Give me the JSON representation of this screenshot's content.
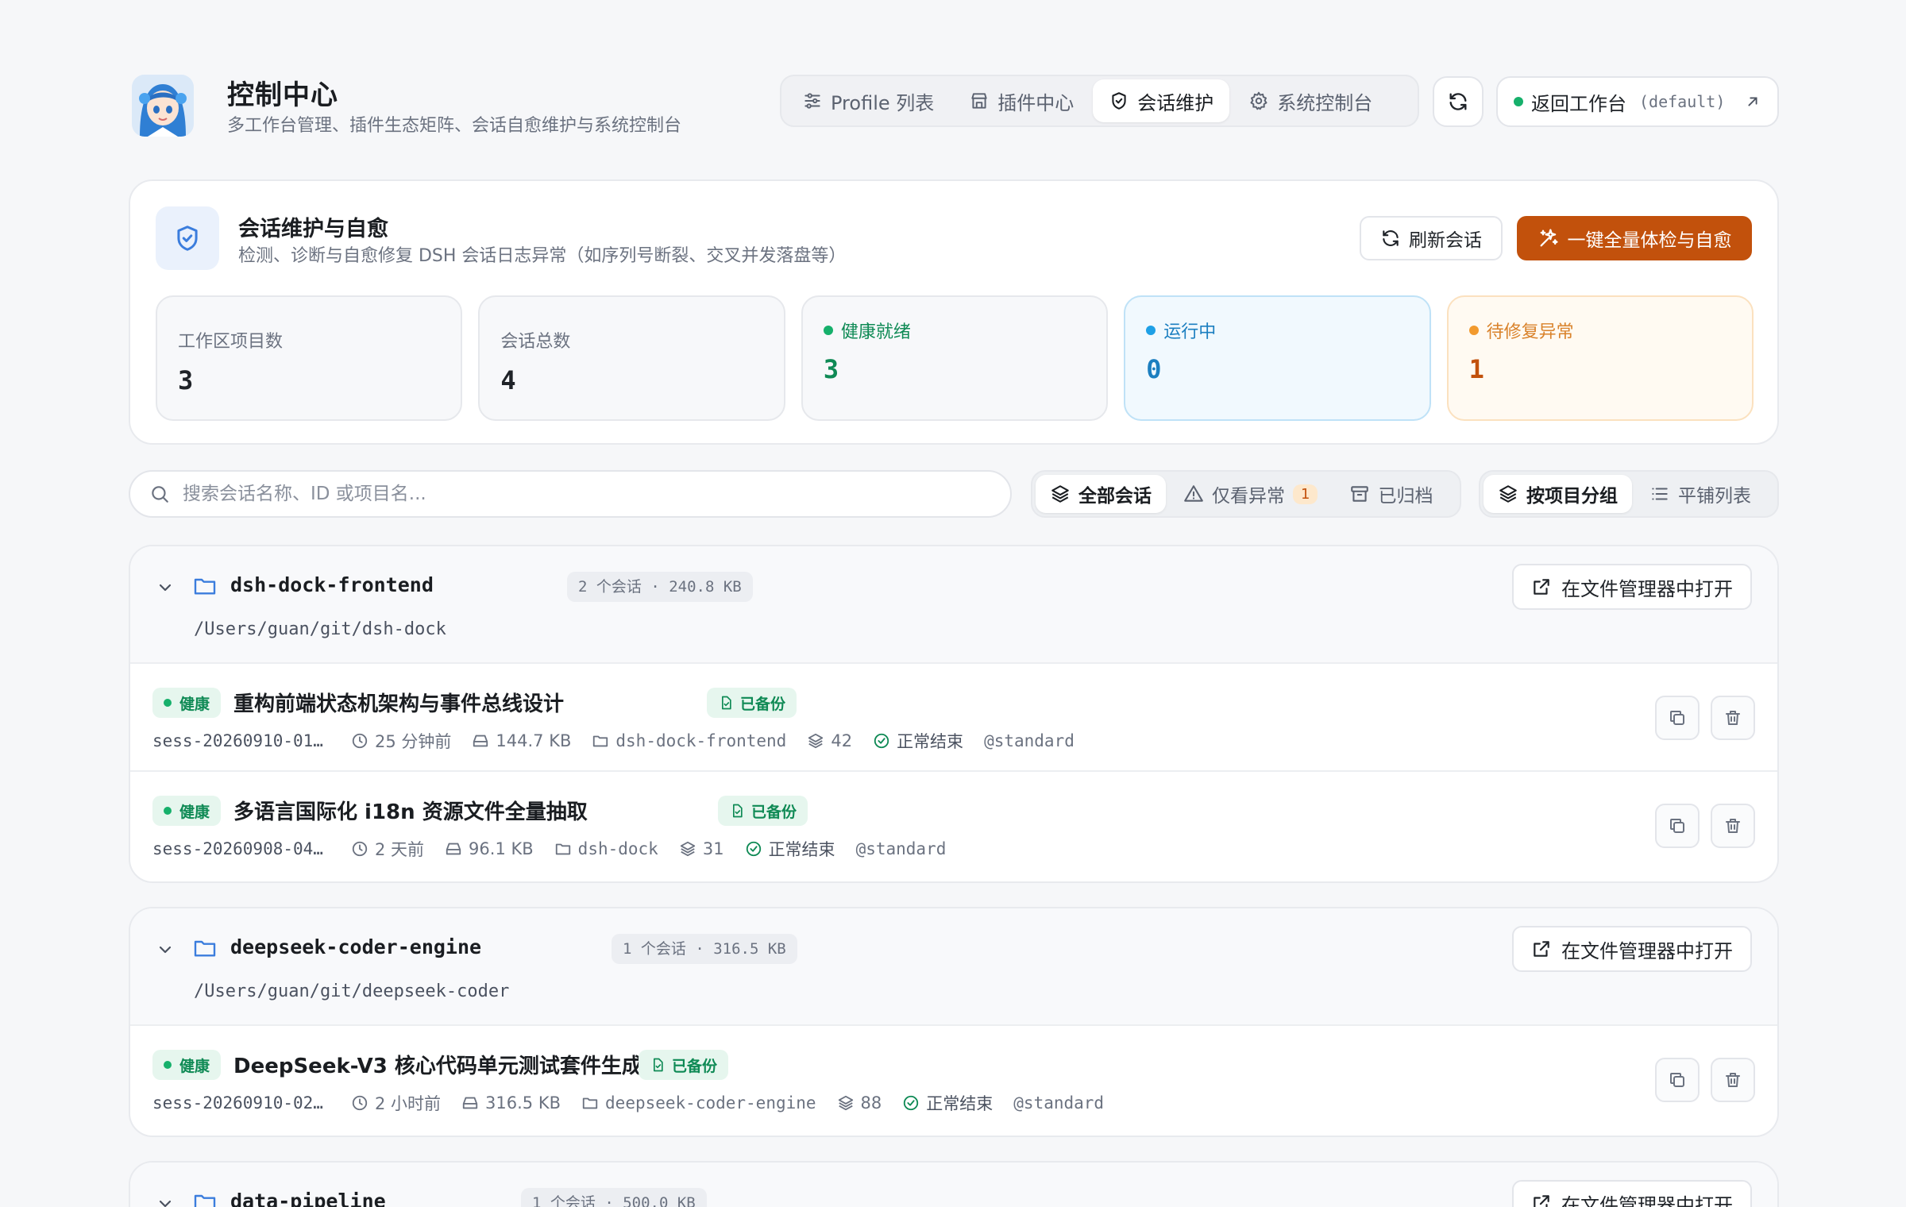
{
  "header": {
    "title": "控制中心",
    "subtitle": "多工作台管理、插件生态矩阵、会话自愈维护与系统控制台",
    "nav": [
      {
        "label": "Profile 列表",
        "icon": "sliders-icon",
        "active": false
      },
      {
        "label": "插件中心",
        "icon": "store-icon",
        "active": false
      },
      {
        "label": "会话维护",
        "icon": "shield-icon",
        "active": true
      },
      {
        "label": "系统控制台",
        "icon": "gear-icon",
        "active": false
      }
    ],
    "back_label": "返回工作台",
    "workspace": "(default)",
    "status_color": "#16b06b"
  },
  "panel": {
    "title": "会话维护与自愈",
    "description": "检测、诊断与自愈修复 DSH 会话日志异常（如序列号断裂、交叉并发落盘等）",
    "refresh_label": "刷新会话",
    "heal_label": "一键全量体检与自愈",
    "stats": [
      {
        "label": "工作区项目数",
        "value": "3",
        "kind": "plain"
      },
      {
        "label": "会话总数",
        "value": "4",
        "kind": "plain"
      },
      {
        "label": "健康就绪",
        "value": "3",
        "kind": "healthy",
        "dot": "#16b06b"
      },
      {
        "label": "运行中",
        "value": "0",
        "kind": "running",
        "dot": "#1ea0e6"
      },
      {
        "label": "待修复异常",
        "value": "1",
        "kind": "pending",
        "dot": "#f29a2e"
      }
    ]
  },
  "toolbar": {
    "search_placeholder": "搜索会话名称、ID 或项目名...",
    "filters": [
      {
        "label": "全部会话",
        "active": true
      },
      {
        "label": "仅看异常",
        "count": "1",
        "active": false
      },
      {
        "label": "已归档",
        "active": false
      }
    ],
    "views": [
      {
        "label": "按项目分组",
        "active": true
      },
      {
        "label": "平铺列表",
        "active": false
      }
    ]
  },
  "groups": [
    {
      "name": "dsh-dock-frontend",
      "meta": "2 个会话 · 240.8 KB",
      "path": "/Users/guan/git/dsh-dock",
      "open_label": "在文件管理器中打开",
      "sessions": [
        {
          "health": "健康",
          "title": "重构前端状态机架构与事件总线设计",
          "backup": "已备份",
          "id": "sess-20260910-01…",
          "time": "25 分钟前",
          "size": "144.7 KB",
          "project": "dsh-dock-frontend",
          "turns": "42",
          "status": "正常结束",
          "profile": "@standard"
        },
        {
          "health": "健康",
          "title": "多语言国际化 i18n 资源文件全量抽取",
          "backup": "已备份",
          "id": "sess-20260908-04…",
          "time": "2 天前",
          "size": "96.1 KB",
          "project": "dsh-dock",
          "turns": "31",
          "status": "正常结束",
          "profile": "@standard"
        }
      ]
    },
    {
      "name": "deepseek-coder-engine",
      "meta": "1 个会话 · 316.5 KB",
      "path": "/Users/guan/git/deepseek-coder",
      "open_label": "在文件管理器中打开",
      "sessions": [
        {
          "health": "健康",
          "title": "DeepSeek-V3 核心代码单元测试套件生成",
          "backup": "已备份",
          "id": "sess-20260910-02…",
          "time": "2 小时前",
          "size": "316.5 KB",
          "project": "deepseek-coder-engine",
          "turns": "88",
          "status": "正常结束",
          "profile": "@standard"
        }
      ]
    },
    {
      "name": "data-pipeline",
      "meta": "1 个会话 · 500.0 KB",
      "open_label": "在文件管理器中打开"
    }
  ],
  "colors": {
    "accent": "#c2510c",
    "healthy": "#0f8a55",
    "running": "#1c7fc0",
    "brand_blue": "#3b7ddd"
  }
}
